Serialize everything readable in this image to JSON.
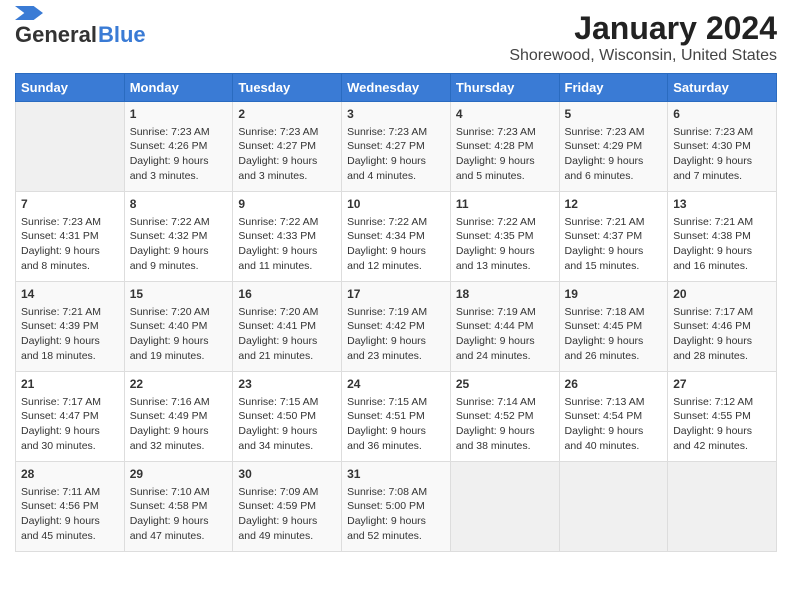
{
  "header": {
    "logo_line1": "General",
    "logo_line2": "Blue",
    "title": "January 2024",
    "subtitle": "Shorewood, Wisconsin, United States"
  },
  "days_of_week": [
    "Sunday",
    "Monday",
    "Tuesday",
    "Wednesday",
    "Thursday",
    "Friday",
    "Saturday"
  ],
  "weeks": [
    [
      {
        "day": "",
        "sunrise": "",
        "sunset": "",
        "daylight": ""
      },
      {
        "day": "1",
        "sunrise": "7:23 AM",
        "sunset": "4:26 PM",
        "daylight": "9 hours and 3 minutes."
      },
      {
        "day": "2",
        "sunrise": "7:23 AM",
        "sunset": "4:27 PM",
        "daylight": "9 hours and 3 minutes."
      },
      {
        "day": "3",
        "sunrise": "7:23 AM",
        "sunset": "4:27 PM",
        "daylight": "9 hours and 4 minutes."
      },
      {
        "day": "4",
        "sunrise": "7:23 AM",
        "sunset": "4:28 PM",
        "daylight": "9 hours and 5 minutes."
      },
      {
        "day": "5",
        "sunrise": "7:23 AM",
        "sunset": "4:29 PM",
        "daylight": "9 hours and 6 minutes."
      },
      {
        "day": "6",
        "sunrise": "7:23 AM",
        "sunset": "4:30 PM",
        "daylight": "9 hours and 7 minutes."
      }
    ],
    [
      {
        "day": "7",
        "sunrise": "7:23 AM",
        "sunset": "4:31 PM",
        "daylight": "9 hours and 8 minutes."
      },
      {
        "day": "8",
        "sunrise": "7:22 AM",
        "sunset": "4:32 PM",
        "daylight": "9 hours and 9 minutes."
      },
      {
        "day": "9",
        "sunrise": "7:22 AM",
        "sunset": "4:33 PM",
        "daylight": "9 hours and 11 minutes."
      },
      {
        "day": "10",
        "sunrise": "7:22 AM",
        "sunset": "4:34 PM",
        "daylight": "9 hours and 12 minutes."
      },
      {
        "day": "11",
        "sunrise": "7:22 AM",
        "sunset": "4:35 PM",
        "daylight": "9 hours and 13 minutes."
      },
      {
        "day": "12",
        "sunrise": "7:21 AM",
        "sunset": "4:37 PM",
        "daylight": "9 hours and 15 minutes."
      },
      {
        "day": "13",
        "sunrise": "7:21 AM",
        "sunset": "4:38 PM",
        "daylight": "9 hours and 16 minutes."
      }
    ],
    [
      {
        "day": "14",
        "sunrise": "7:21 AM",
        "sunset": "4:39 PM",
        "daylight": "9 hours and 18 minutes."
      },
      {
        "day": "15",
        "sunrise": "7:20 AM",
        "sunset": "4:40 PM",
        "daylight": "9 hours and 19 minutes."
      },
      {
        "day": "16",
        "sunrise": "7:20 AM",
        "sunset": "4:41 PM",
        "daylight": "9 hours and 21 minutes."
      },
      {
        "day": "17",
        "sunrise": "7:19 AM",
        "sunset": "4:42 PM",
        "daylight": "9 hours and 23 minutes."
      },
      {
        "day": "18",
        "sunrise": "7:19 AM",
        "sunset": "4:44 PM",
        "daylight": "9 hours and 24 minutes."
      },
      {
        "day": "19",
        "sunrise": "7:18 AM",
        "sunset": "4:45 PM",
        "daylight": "9 hours and 26 minutes."
      },
      {
        "day": "20",
        "sunrise": "7:17 AM",
        "sunset": "4:46 PM",
        "daylight": "9 hours and 28 minutes."
      }
    ],
    [
      {
        "day": "21",
        "sunrise": "7:17 AM",
        "sunset": "4:47 PM",
        "daylight": "9 hours and 30 minutes."
      },
      {
        "day": "22",
        "sunrise": "7:16 AM",
        "sunset": "4:49 PM",
        "daylight": "9 hours and 32 minutes."
      },
      {
        "day": "23",
        "sunrise": "7:15 AM",
        "sunset": "4:50 PM",
        "daylight": "9 hours and 34 minutes."
      },
      {
        "day": "24",
        "sunrise": "7:15 AM",
        "sunset": "4:51 PM",
        "daylight": "9 hours and 36 minutes."
      },
      {
        "day": "25",
        "sunrise": "7:14 AM",
        "sunset": "4:52 PM",
        "daylight": "9 hours and 38 minutes."
      },
      {
        "day": "26",
        "sunrise": "7:13 AM",
        "sunset": "4:54 PM",
        "daylight": "9 hours and 40 minutes."
      },
      {
        "day": "27",
        "sunrise": "7:12 AM",
        "sunset": "4:55 PM",
        "daylight": "9 hours and 42 minutes."
      }
    ],
    [
      {
        "day": "28",
        "sunrise": "7:11 AM",
        "sunset": "4:56 PM",
        "daylight": "9 hours and 45 minutes."
      },
      {
        "day": "29",
        "sunrise": "7:10 AM",
        "sunset": "4:58 PM",
        "daylight": "9 hours and 47 minutes."
      },
      {
        "day": "30",
        "sunrise": "7:09 AM",
        "sunset": "4:59 PM",
        "daylight": "9 hours and 49 minutes."
      },
      {
        "day": "31",
        "sunrise": "7:08 AM",
        "sunset": "5:00 PM",
        "daylight": "9 hours and 52 minutes."
      },
      {
        "day": "",
        "sunrise": "",
        "sunset": "",
        "daylight": ""
      },
      {
        "day": "",
        "sunrise": "",
        "sunset": "",
        "daylight": ""
      },
      {
        "day": "",
        "sunrise": "",
        "sunset": "",
        "daylight": ""
      }
    ]
  ]
}
